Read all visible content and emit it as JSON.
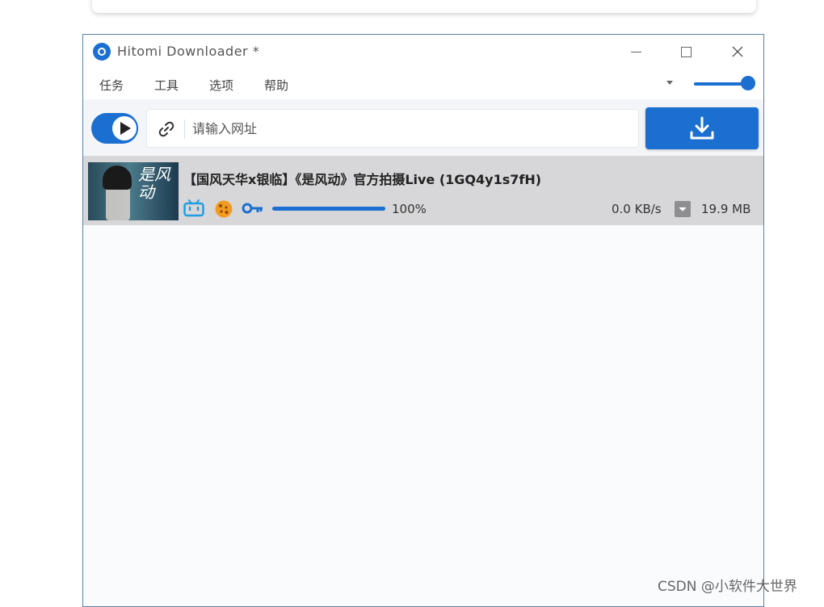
{
  "window": {
    "title": "Hitomi Downloader *"
  },
  "menu": [
    {
      "label": "任务"
    },
    {
      "label": "工具"
    },
    {
      "label": "选项"
    },
    {
      "label": "帮助"
    }
  ],
  "volume": {
    "level": 1.0
  },
  "url_bar": {
    "placeholder": "请输入网址",
    "value": ""
  },
  "icons": {
    "app": "hitomi-logo-icon",
    "play": "play-icon",
    "link": "link-icon",
    "download": "download-icon",
    "site": "bilibili-icon",
    "cookie": "cookie-icon",
    "key": "key-icon",
    "file": "file-icon"
  },
  "colors": {
    "accent": "#1b6fd1",
    "task_row_bg": "#d7d7d9"
  },
  "tasks": [
    {
      "title": "【国风天华x银临】《是风动》官方拍摄Live (1GQ4y1s7fH)",
      "thumb_text": "是风动",
      "progress": 1.0,
      "progress_label": "100%",
      "speed": "0.0 KB/s",
      "size": "19.9 MB"
    }
  ],
  "watermark": "CSDN @小软件大世界"
}
